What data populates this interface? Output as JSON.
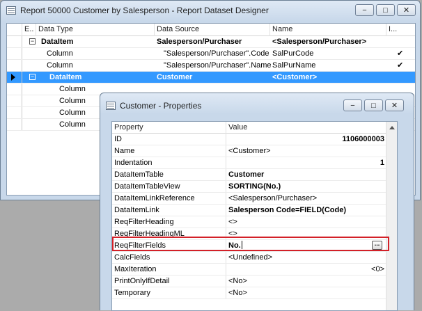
{
  "main_window": {
    "title": "Report 50000 Customer by Salesperson - Report Dataset Designer",
    "controls": {
      "minimize": "−",
      "maximize": "□",
      "close": "✕"
    },
    "columns": [
      "E..",
      "Data Type",
      "Data Source",
      "Name",
      "I..."
    ],
    "rows": [
      {
        "expander": "−",
        "type": "DataItem",
        "source": "Salesperson/Purchaser",
        "name": "<Salesperson/Purchaser>",
        "include": "",
        "bold": true
      },
      {
        "expander": "",
        "type": "Column",
        "source": "\"Salesperson/Purchaser\".Code",
        "name": "SalPurCode",
        "include": "✔",
        "bold": false
      },
      {
        "expander": "",
        "type": "Column",
        "source": "\"Salesperson/Purchaser\".Name",
        "name": "SalPurName",
        "include": "✔",
        "bold": false
      },
      {
        "expander": "−",
        "type": "DataItem",
        "source": "Customer",
        "name": "<Customer>",
        "include": "",
        "bold": true,
        "selected": true
      },
      {
        "expander": "",
        "type": "Column",
        "source": "",
        "name": "",
        "include": ""
      },
      {
        "expander": "",
        "type": "Column",
        "source": "",
        "name": "",
        "include": ""
      },
      {
        "expander": "",
        "type": "Column",
        "source": "",
        "name": "",
        "include": ""
      },
      {
        "expander": "",
        "type": "Column",
        "source": "",
        "name": "",
        "include": ""
      }
    ]
  },
  "props_window": {
    "title": "Customer - Properties",
    "controls": {
      "minimize": "−",
      "maximize": "□",
      "close": "✕"
    },
    "columns": [
      "Property",
      "Value"
    ],
    "rows": [
      {
        "name": "ID",
        "value": "1106000003",
        "bold": true,
        "align": "right"
      },
      {
        "name": "Name",
        "value": "<Customer>",
        "bold": false
      },
      {
        "name": "Indentation",
        "value": "1",
        "bold": true,
        "align": "right"
      },
      {
        "name": "DataItemTable",
        "value": "Customer",
        "bold": true
      },
      {
        "name": "DataItemTableView",
        "value": "SORTING(No.)",
        "bold": true
      },
      {
        "name": "DataItemLinkReference",
        "value": "<Salesperson/Purchaser>",
        "bold": false
      },
      {
        "name": "DataItemLink",
        "value": "Salesperson Code=FIELD(Code)",
        "bold": true
      },
      {
        "name": "ReqFilterHeading",
        "value": "<>",
        "bold": false
      },
      {
        "name": "ReqFilterHeadingML",
        "value": "<>",
        "bold": false
      },
      {
        "name": "ReqFilterFields",
        "value": "No.",
        "bold": true,
        "editing": true
      },
      {
        "name": "CalcFields",
        "value": "<Undefined>",
        "bold": false
      },
      {
        "name": "MaxIteration",
        "value": "<0>",
        "bold": false,
        "align": "right"
      },
      {
        "name": "PrintOnlyIfDetail",
        "value": "<No>",
        "bold": false
      },
      {
        "name": "Temporary",
        "value": "<No>",
        "bold": false
      }
    ],
    "assist_button": "...",
    "highlight_color": "#d32028"
  },
  "colors": {
    "selection": "#3399ff",
    "desktop": "#ababab",
    "frame": "#c8d8ea"
  }
}
